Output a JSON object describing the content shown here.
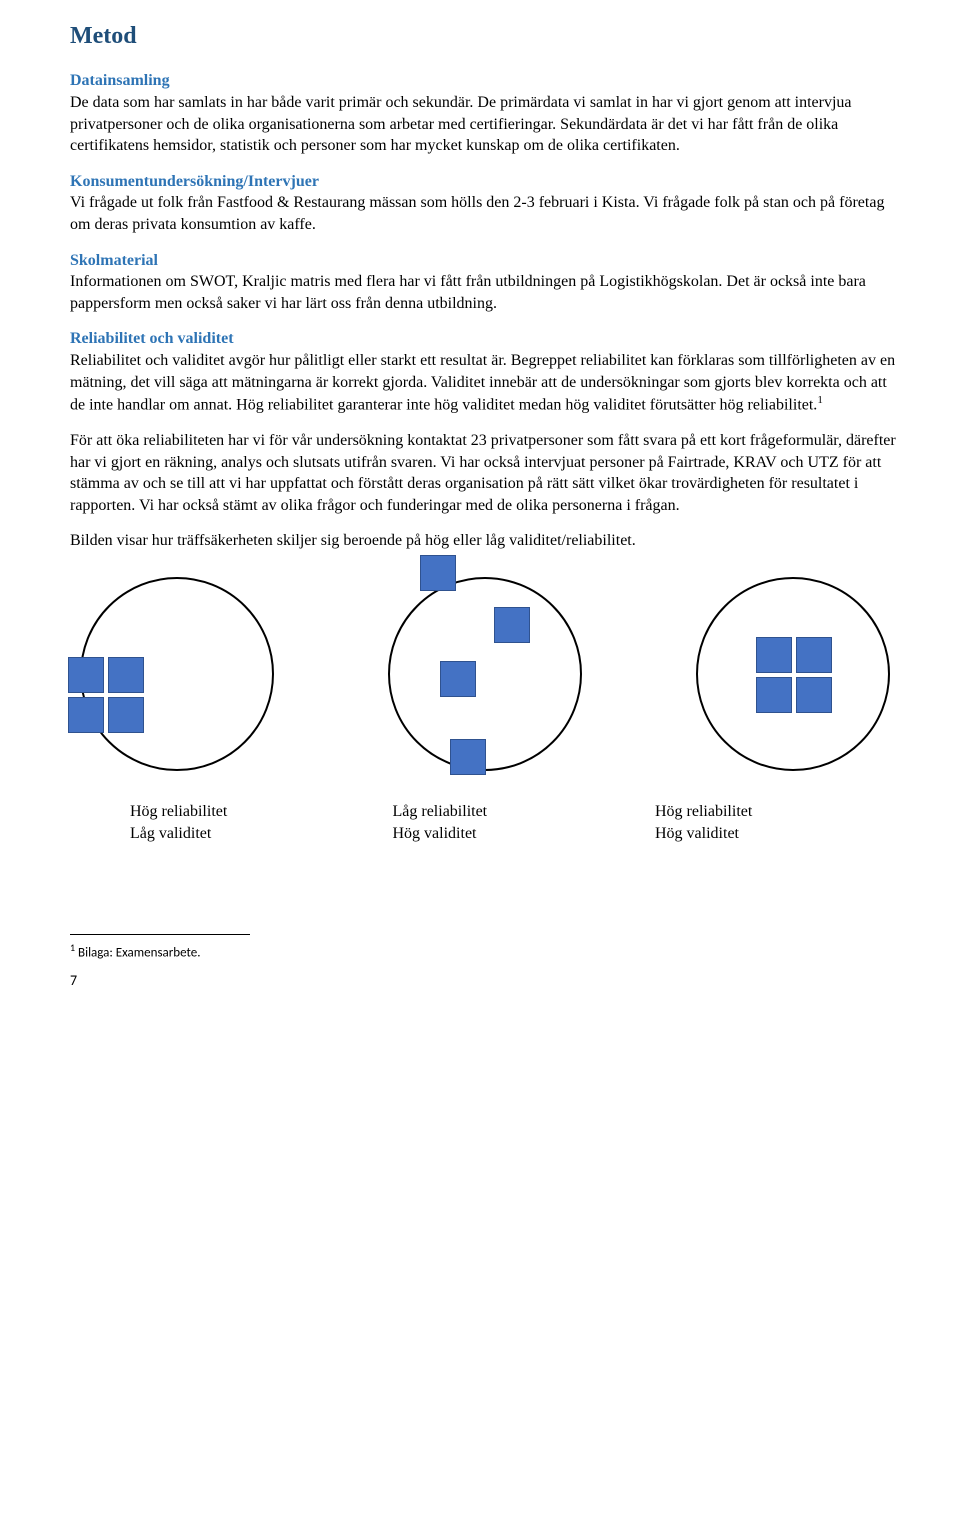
{
  "title": "Metod",
  "sections": {
    "datainsamling": {
      "heading": "Datainsamling",
      "body": "De data som har samlats in har både varit primär och sekundär. De primärdata vi samlat in har vi gjort genom att intervjua privatpersoner och de olika organisationerna som arbetar med certifieringar. Sekundärdata är det vi har fått från de olika certifikatens hemsidor, statistik och personer som har mycket kunskap om de olika certifikaten."
    },
    "konsument": {
      "heading": "Konsumentundersökning/Intervjuer",
      "body": "Vi frågade ut folk från Fastfood & Restaurang mässan som hölls den 2-3 februari i Kista. Vi frågade folk på stan och på företag om deras privata konsumtion av kaffe."
    },
    "skolmaterial": {
      "heading": "Skolmaterial",
      "body": "Informationen om SWOT, Kraljic matris med flera har vi fått från utbildningen på Logistikhögskolan. Det är också inte bara pappersform men också saker vi har lärt oss från denna utbildning."
    },
    "reliabilitet": {
      "heading": "Reliabilitet och validitet",
      "body1_pre": "Reliabilitet och validitet avgör hur pålitligt eller starkt ett resultat är. Begreppet reliabilitet kan förklaras som tillförligheten av en mätning, det vill säga att mätningarna är korrekt gjorda. Validitet innebär att de undersökningar som gjorts blev korrekta och att de inte handlar om annat. Hög reliabilitet garanterar inte hög validitet medan hög validitet förutsätter hög reliabilitet.",
      "fn_marker": "1",
      "body2": "För att öka reliabiliteten har vi för vår undersökning kontaktat 23 privatpersoner som fått svara på ett kort frågeformulär, därefter har vi gjort en räkning, analys och slutsats utifrån svaren. Vi har också intervjuat personer på Fairtrade, KRAV och UTZ för att stämma av och se till att vi har uppfattat och förstått deras organisation på rätt sätt vilket ökar trovärdigheten för resultatet i rapporten. Vi har också stämt av olika frågor och funderingar med de olika personerna i frågan.",
      "body3": "Bilden visar hur träffsäkerheten skiljer sig beroende på hög eller låg validitet/reliabilitet."
    }
  },
  "diagram_labels": [
    {
      "line1": "Hög reliabilitet",
      "line2": "Låg validitet"
    },
    {
      "line1": "Låg reliabilitet",
      "line2": "Hög validitet"
    },
    {
      "line1": "Hög reliabilitet",
      "line2": "Hög validitet"
    }
  ],
  "footnote": {
    "marker": "1",
    "text": " Bilaga: Examensarbete."
  },
  "page_number": "7"
}
